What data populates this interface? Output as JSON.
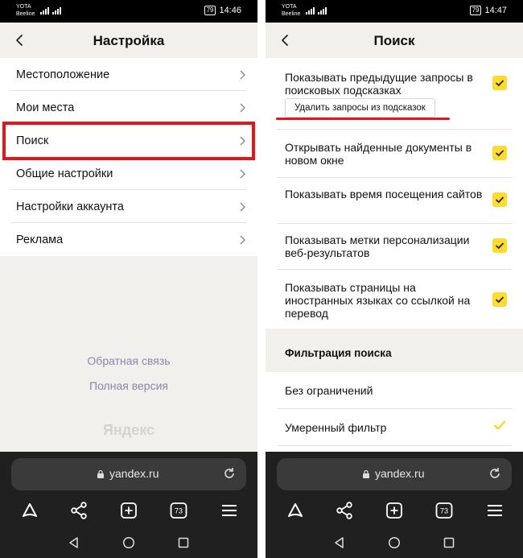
{
  "status_bar": {
    "carrier_top": "YOTA",
    "carrier_bottom": "Beeline",
    "battery": "79"
  },
  "left": {
    "time": "14:46",
    "title": "Настройка",
    "menu": [
      "Местоположение",
      "Мои места",
      "Поиск",
      "Общие настройки",
      "Настройки аккаунта",
      "Реклама"
    ],
    "feedback": "Обратная связь",
    "full_version": "Полная версия",
    "logo": "Яндекс"
  },
  "right": {
    "time": "14:47",
    "title": "Поиск",
    "settings": [
      {
        "label": "Показывать предыдущие запросы в поисковых подсказках",
        "checked": true
      },
      {
        "label": "Открывать найденные документы в новом окне",
        "checked": true
      },
      {
        "label": "Показывать время посещения сайтов",
        "checked": true
      },
      {
        "label": "Показывать метки персонализации веб-результатов",
        "checked": true
      },
      {
        "label": "Показывать страницы на иностранных языках со ссылкой на перевод",
        "checked": true
      }
    ],
    "clear_button": "Удалить запросы из подсказок",
    "section": "Фильтрация поиска",
    "filters": [
      {
        "label": "Без ограничений",
        "selected": false
      },
      {
        "label": "Умеренный фильтр",
        "selected": true
      }
    ]
  },
  "browser": {
    "url": "yandex.ru",
    "tabs_count": "73"
  },
  "colors": {
    "accent_yellow": "#ffdb2e",
    "highlight_red": "#e4161d",
    "link_purple": "#8d86a8"
  }
}
